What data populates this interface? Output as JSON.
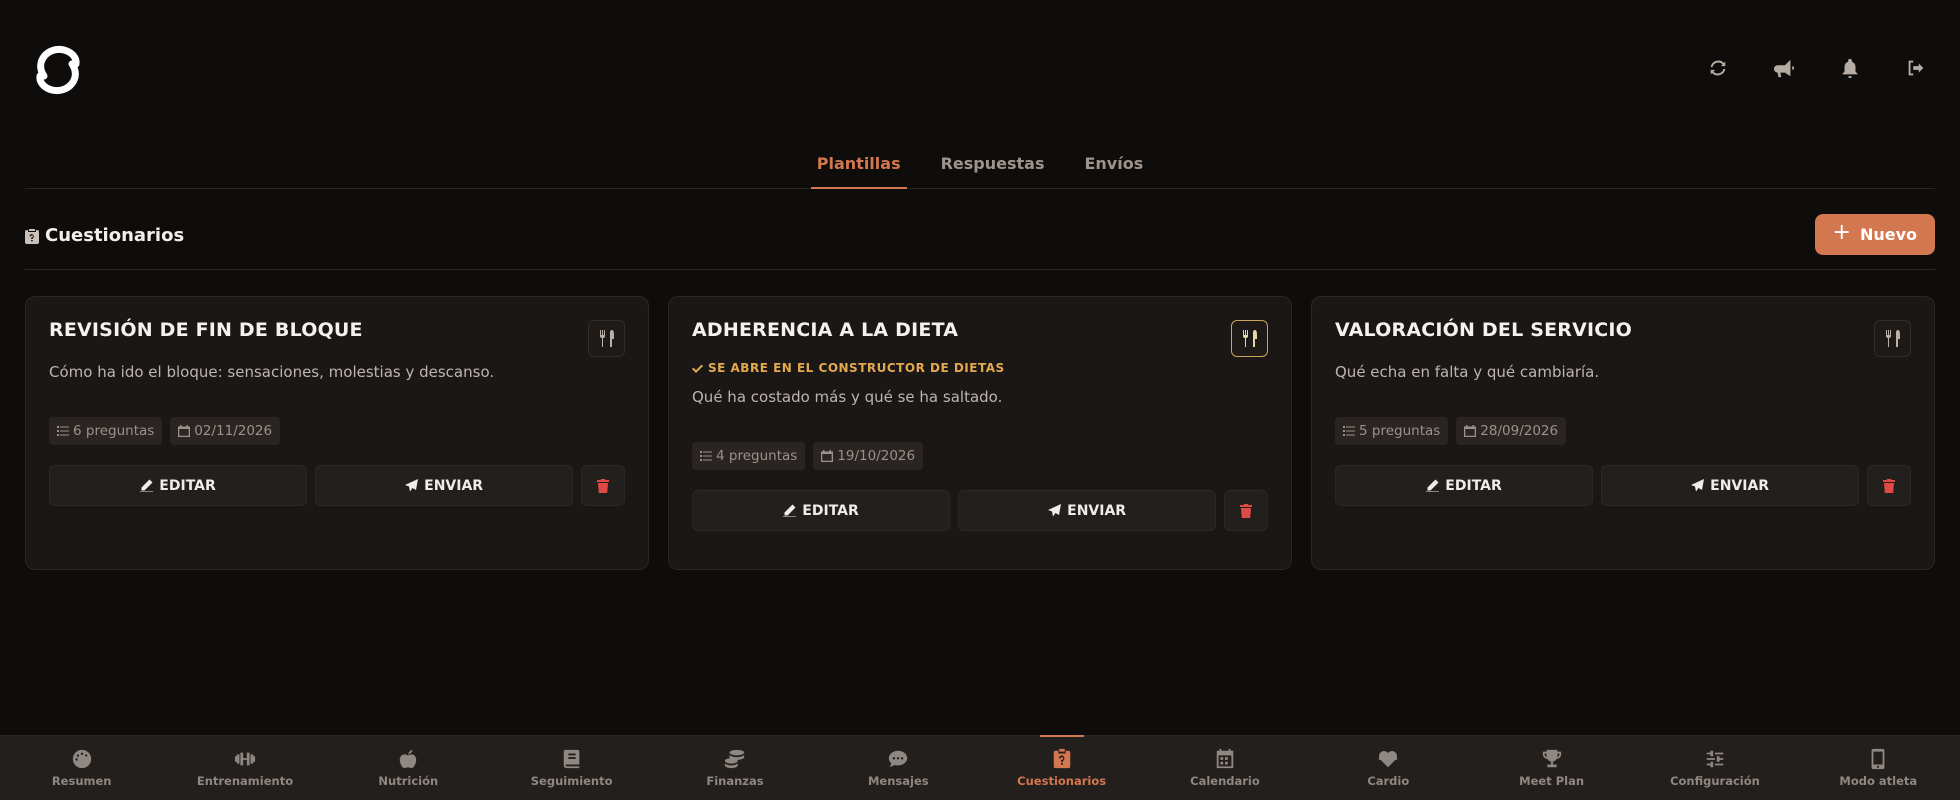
{
  "tabs": [
    {
      "label": "Plantillas",
      "active": true
    },
    {
      "label": "Respuestas",
      "active": false
    },
    {
      "label": "Envíos",
      "active": false
    }
  ],
  "section": {
    "title": "Cuestionarios",
    "new_label": "Nuevo"
  },
  "cards": [
    {
      "title": "REVISIÓN DE FIN DE BLOQUE",
      "description": "Cómo ha ido el bloque: sensaciones, molestias y descanso.",
      "questions": "6 preguntas",
      "date": "02/11/2026",
      "edit_label": "EDITAR",
      "send_label": "ENVIAR"
    },
    {
      "title": "ADHERENCIA A LA DIETA",
      "badge": "SE ABRE EN EL CONSTRUCTOR DE DIETAS",
      "description": "Qué ha costado más y qué se ha saltado.",
      "questions": "4 preguntas",
      "date": "19/10/2026",
      "edit_label": "EDITAR",
      "send_label": "ENVIAR"
    },
    {
      "title": "VALORACIÓN DEL SERVICIO",
      "description": "Qué echa en falta y qué cambiaría.",
      "questions": "5 preguntas",
      "date": "28/09/2026",
      "edit_label": "EDITAR",
      "send_label": "ENVIAR"
    }
  ],
  "nav": [
    {
      "label": "Resumen",
      "icon": "gauge-icon"
    },
    {
      "label": "Entrenamiento",
      "icon": "dumbbell-icon"
    },
    {
      "label": "Nutrición",
      "icon": "apple-icon"
    },
    {
      "label": "Seguimiento",
      "icon": "book-icon"
    },
    {
      "label": "Finanzas",
      "icon": "coins-icon"
    },
    {
      "label": "Mensajes",
      "icon": "chat-icon"
    },
    {
      "label": "Cuestionarios",
      "icon": "clipboard-question-icon",
      "active": true
    },
    {
      "label": "Calendario",
      "icon": "calendar-icon"
    },
    {
      "label": "Cardio",
      "icon": "heartbeat-icon"
    },
    {
      "label": "Meet Plan",
      "icon": "trophy-icon"
    },
    {
      "label": "Configuración",
      "icon": "sliders-icon"
    },
    {
      "label": "Modo atleta",
      "icon": "mobile-icon"
    }
  ],
  "top_icons": [
    "sync-icon",
    "megaphone-icon",
    "bell-icon",
    "logout-icon"
  ],
  "colors": {
    "accent": "#d2774f",
    "badge": "#e4a94f",
    "danger": "#e04a46",
    "background": "#0f0d0c",
    "card": "#1a1716"
  }
}
